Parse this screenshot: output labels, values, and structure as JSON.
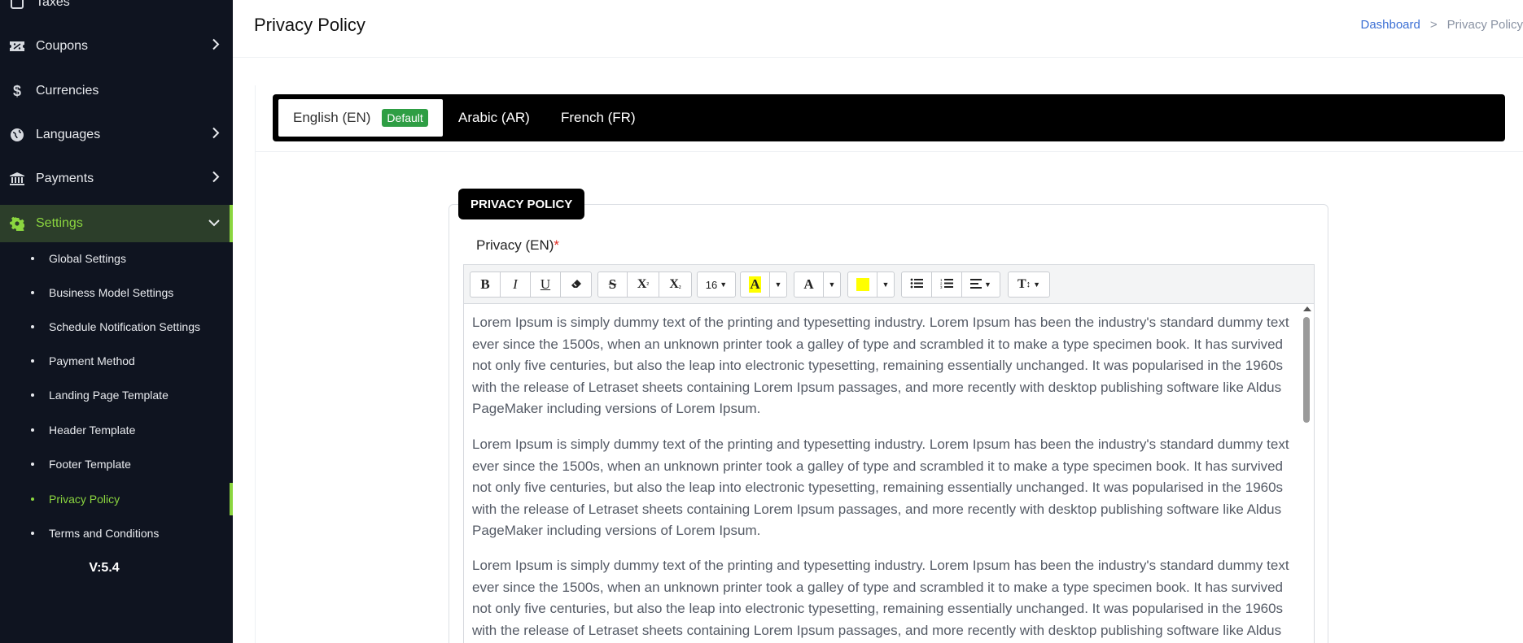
{
  "sidebar": {
    "taxes_label": "Taxes",
    "items": [
      {
        "label": "Coupons",
        "icon": "ticket-percent-icon"
      },
      {
        "label": "Currencies",
        "icon": "dollar-icon"
      },
      {
        "label": "Languages",
        "icon": "globe-icon"
      },
      {
        "label": "Payments",
        "icon": "bank-icon"
      },
      {
        "label": "Settings",
        "icon": "gear-icon"
      }
    ],
    "settings_sub": [
      "Global Settings",
      "Business Model Settings",
      "Schedule Notification Settings",
      "Payment Method",
      "Landing Page Template",
      "Header Template",
      "Footer Template",
      "Privacy Policy",
      "Terms and Conditions"
    ],
    "version": "V:5.4",
    "accent_color": "#8bd63f"
  },
  "header": {
    "title": "Privacy Policy",
    "breadcrumb": {
      "home": "Dashboard",
      "separator": ">",
      "current": "Privacy Policy"
    }
  },
  "tabs": [
    {
      "label": "English (EN)",
      "badge": "Default",
      "active": true
    },
    {
      "label": "Arabic (AR)"
    },
    {
      "label": "French (FR)"
    }
  ],
  "form": {
    "legend": "PRIVACY POLICY",
    "field_label": "Privacy (EN)",
    "required_mark": "*"
  },
  "toolbar": {
    "bold": "B",
    "italic": "I",
    "underline": "U",
    "strike": "S",
    "superscript": "X",
    "superscript_mark": "²",
    "subscript": "X",
    "subscript_mark": "₂",
    "font_size": "16",
    "font_color": "A",
    "back_color": "A",
    "text_size": "T",
    "text_size_mark": "↕"
  },
  "content": {
    "paragraphs": [
      "Lorem Ipsum is simply dummy text of the printing and typesetting industry. Lorem Ipsum has been the industry's standard dummy text ever since the 1500s, when an unknown printer took a galley of type and scrambled it to make a type specimen book. It has survived not only five centuries, but also the leap into electronic typesetting, remaining essentially unchanged. It was popularised in the 1960s with the release of Letraset sheets containing Lorem Ipsum passages, and more recently with desktop publishing software like Aldus PageMaker including versions of Lorem Ipsum.",
      "Lorem Ipsum is simply dummy text of the printing and typesetting industry. Lorem Ipsum has been the industry's standard dummy text ever since the 1500s, when an unknown printer took a galley of type and scrambled it to make a type specimen book. It has survived not only five centuries, but also the leap into electronic typesetting, remaining essentially unchanged. It was popularised in the 1960s with the release of Letraset sheets containing Lorem Ipsum passages, and more recently with desktop publishing software like Aldus PageMaker including versions of Lorem Ipsum.",
      "Lorem Ipsum is simply dummy text of the printing and typesetting industry. Lorem Ipsum has been the industry's standard dummy text ever since the 1500s, when an unknown printer took a galley of type and scrambled it to make a type specimen book. It has survived not only five centuries, but also the leap into electronic typesetting, remaining essentially unchanged. It was popularised in the 1960s with the release of Letraset sheets containing Lorem Ipsum passages, and more recently with desktop publishing software like Aldus PageMaker including versions of Lorem Ipsum."
    ]
  }
}
